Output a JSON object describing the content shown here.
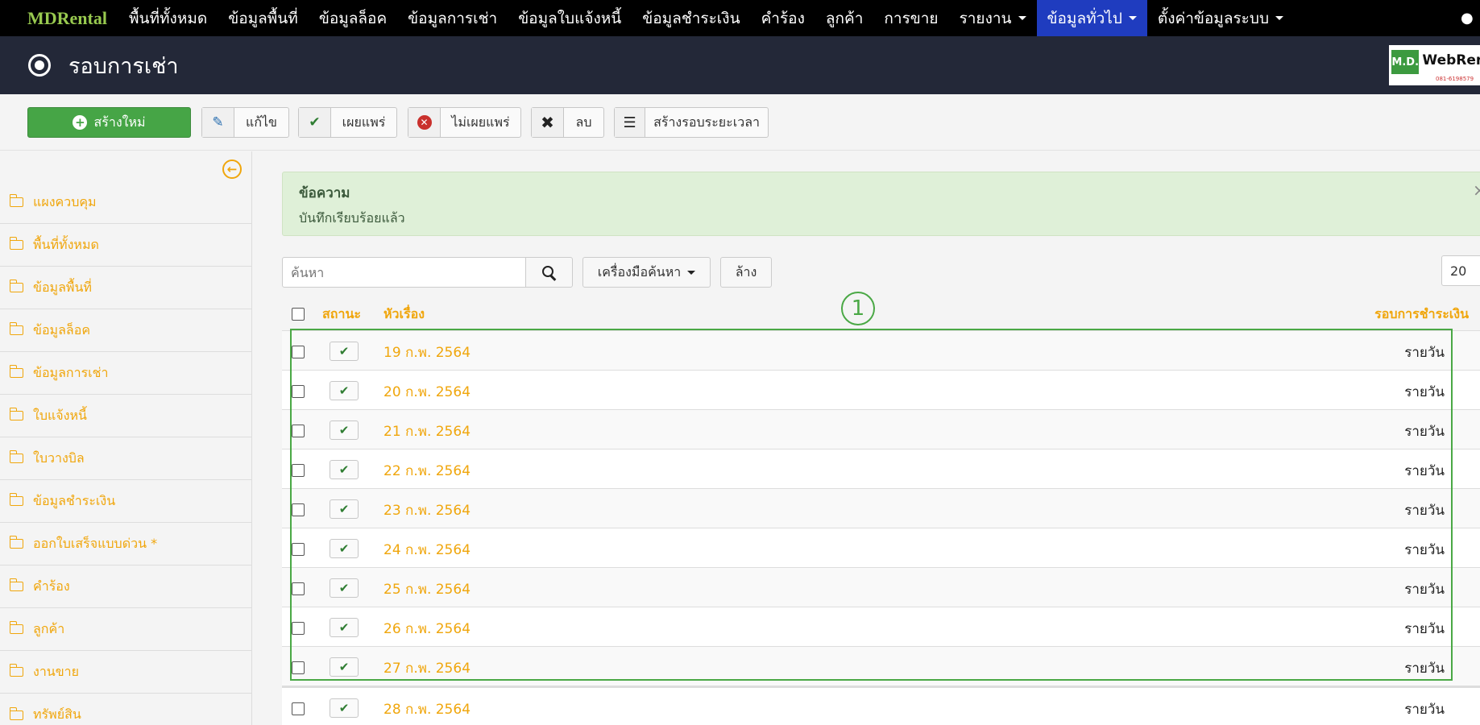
{
  "navbar": {
    "brand": "MDRental",
    "items": [
      {
        "label": "พื้นที่ทั้งหมด",
        "dropdown": false,
        "active": false
      },
      {
        "label": "ข้อมูลพื้นที่",
        "dropdown": false,
        "active": false
      },
      {
        "label": "ข้อมูลล็อค",
        "dropdown": false,
        "active": false
      },
      {
        "label": "ข้อมูลการเช่า",
        "dropdown": false,
        "active": false
      },
      {
        "label": "ข้อมูลใบแจ้งหนี้",
        "dropdown": false,
        "active": false
      },
      {
        "label": "ข้อมูลชำระเงิน",
        "dropdown": false,
        "active": false
      },
      {
        "label": "คำร้อง",
        "dropdown": false,
        "active": false
      },
      {
        "label": "ลูกค้า",
        "dropdown": false,
        "active": false
      },
      {
        "label": "การขาย",
        "dropdown": false,
        "active": false
      },
      {
        "label": "รายงาน",
        "dropdown": true,
        "active": false
      },
      {
        "label": "ข้อมูลทั่วไป",
        "dropdown": true,
        "active": true
      },
      {
        "label": "ตั้งค่าข้อมูลระบบ",
        "dropdown": true,
        "active": false
      }
    ],
    "active_color": "#1f3cbf"
  },
  "header": {
    "title": "รอบการเช่า",
    "logo": {
      "badge": "M.D.",
      "name": "WebRen",
      "phone": "081-6198579"
    }
  },
  "toolbar": {
    "new_label": "สร้างใหม่",
    "edit_label": "แก้ไข",
    "publish_label": "เผยแพร่",
    "unpublish_label": "ไม่เผยแพร่",
    "delete_label": "ลบ",
    "create_period_label": "สร้างรอบระยะเวลา"
  },
  "sidebar": {
    "items": [
      "แผงควบคุม",
      "พื้นที่ทั้งหมด",
      "ข้อมูลพื้นที่",
      "ข้อมูลล็อค",
      "ข้อมูลการเช่า",
      "ใบแจ้งหนี้",
      "ใบวางบิล",
      "ข้อมูลชำระเงิน",
      "ออกใบเสร็จแบบด่วน *",
      "คำร้อง",
      "ลูกค้า",
      "งานขาย",
      "ทรัพย์สิน"
    ]
  },
  "alert": {
    "heading": "ข้อความ",
    "message": "บันทึกเรียบร้อยแล้ว",
    "close": "×"
  },
  "filters": {
    "search_placeholder": "ค้นหา",
    "tools_label": "เครื่องมือค้นหา",
    "clear_label": "ล้าง",
    "limit_value": "20"
  },
  "table": {
    "headers": {
      "status": "สถานะ",
      "title": "หัวเรื่อง",
      "cycle": "รอบการชำระเงิน"
    },
    "rows": [
      {
        "title": "19 ก.พ. 2564",
        "cycle": "รายวัน",
        "published": true
      },
      {
        "title": "20 ก.พ. 2564",
        "cycle": "รายวัน",
        "published": true
      },
      {
        "title": "21 ก.พ. 2564",
        "cycle": "รายวัน",
        "published": true
      },
      {
        "title": "22 ก.พ. 2564",
        "cycle": "รายวัน",
        "published": true
      },
      {
        "title": "23 ก.พ. 2564",
        "cycle": "รายวัน",
        "published": true
      },
      {
        "title": "24 ก.พ. 2564",
        "cycle": "รายวัน",
        "published": true
      },
      {
        "title": "25 ก.พ. 2564",
        "cycle": "รายวัน",
        "published": true
      },
      {
        "title": "26 ก.พ. 2564",
        "cycle": "รายวัน",
        "published": true
      },
      {
        "title": "27 ก.พ. 2564",
        "cycle": "รายวัน",
        "published": true
      },
      {
        "title": "28 ก.พ. 2564",
        "cycle": "รายวัน",
        "published": true
      }
    ]
  },
  "annotation": {
    "number": "1",
    "color": "#4aa845"
  },
  "colors": {
    "accent": "#f0a60c",
    "success": "#46a546",
    "header_bg": "#232838"
  }
}
